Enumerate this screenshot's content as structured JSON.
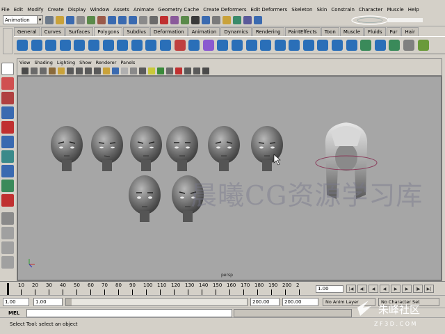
{
  "menu": [
    "File",
    "Edit",
    "Modify",
    "Create",
    "Display",
    "Window",
    "Assets",
    "Animate",
    "Geometry Cache",
    "Create Deformers",
    "Edit Deformers",
    "Skeleton",
    "Skin",
    "Constrain",
    "Character",
    "Muscle",
    "Help"
  ],
  "status": {
    "mode": "Animation"
  },
  "shelf": {
    "tabs": [
      "General",
      "Curves",
      "Surfaces",
      "Polygons",
      "Subdivs",
      "Deformation",
      "Animation",
      "Dynamics",
      "Rendering",
      "PaintEffects",
      "Toon",
      "Muscle",
      "Fluids",
      "Fur",
      "Hair"
    ],
    "active_tab": "Polygons"
  },
  "panel": {
    "menu": [
      "View",
      "Shading",
      "Lighting",
      "Show",
      "Renderer",
      "Panels"
    ],
    "camera": "persp",
    "watermark": "晨曦CG资源学习库"
  },
  "timeline": {
    "ticks": [
      "1",
      "10",
      "20",
      "30",
      "40",
      "50",
      "60",
      "70",
      "80",
      "90",
      "100",
      "110",
      "120",
      "130",
      "140",
      "150",
      "160",
      "170",
      "180",
      "190",
      "200",
      "2"
    ],
    "current_frame": "1.00"
  },
  "range": {
    "start": "1.00",
    "playback_start": "1.00",
    "playback_end": "200.00",
    "end": "200.00",
    "anim_layer": "No Anim Layer",
    "character_set": "No Character Set"
  },
  "cmdline": {
    "label": "MEL"
  },
  "help": {
    "text": "Select Tool: select an object"
  },
  "branding": {
    "site": "Z F 3 D . C O M",
    "name": "朱峰社区"
  },
  "colors": {
    "viewport_bg": "#a6a6a6",
    "ui_bg": "#d4d0c8",
    "shelf_icon": "#2a6fb8"
  }
}
